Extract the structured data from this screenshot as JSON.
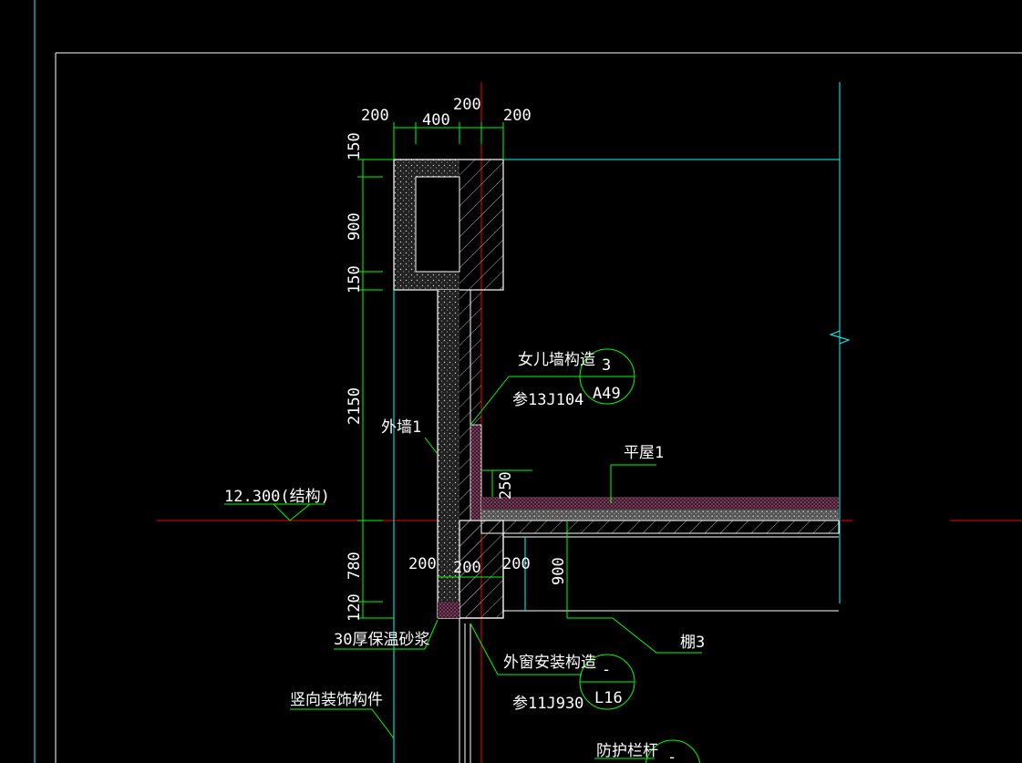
{
  "drawing": {
    "dimensions_top": [
      "200",
      "400",
      "200",
      "200"
    ],
    "dimensions_left": [
      "150",
      "900",
      "150",
      "2150",
      "780",
      "120"
    ],
    "dimensions_lower": [
      "200",
      "200",
      "200",
      "900",
      "250"
    ],
    "labels": {
      "parapet_structure": "女儿墙构造",
      "parapet_ref": "参13J104",
      "parapet_callout_num": "3",
      "parapet_callout_sheet": "A49",
      "flat_roof": "平屋1",
      "outer_wall": "外墙1",
      "elevation": "12.300(结构)",
      "insulation_mortar": "30厚保温砂浆",
      "vertical_decor": "竖向装饰构件",
      "window_install": "外窗安装构造",
      "window_ref": "参11J930",
      "window_callout_num": "-",
      "window_callout_sheet": "L16",
      "ceiling": "棚3",
      "guardrail": "防护栏杆",
      "guardrail_callout_num": "-"
    }
  },
  "colors": {
    "background": "#000000",
    "dimension": "#00ff00",
    "outline": "#ffffff",
    "text": "#ffffff",
    "axis": "#ff0000",
    "grid": "#00ffff",
    "insulation": "#ff66aa",
    "hatch": "#9a9a9a"
  }
}
